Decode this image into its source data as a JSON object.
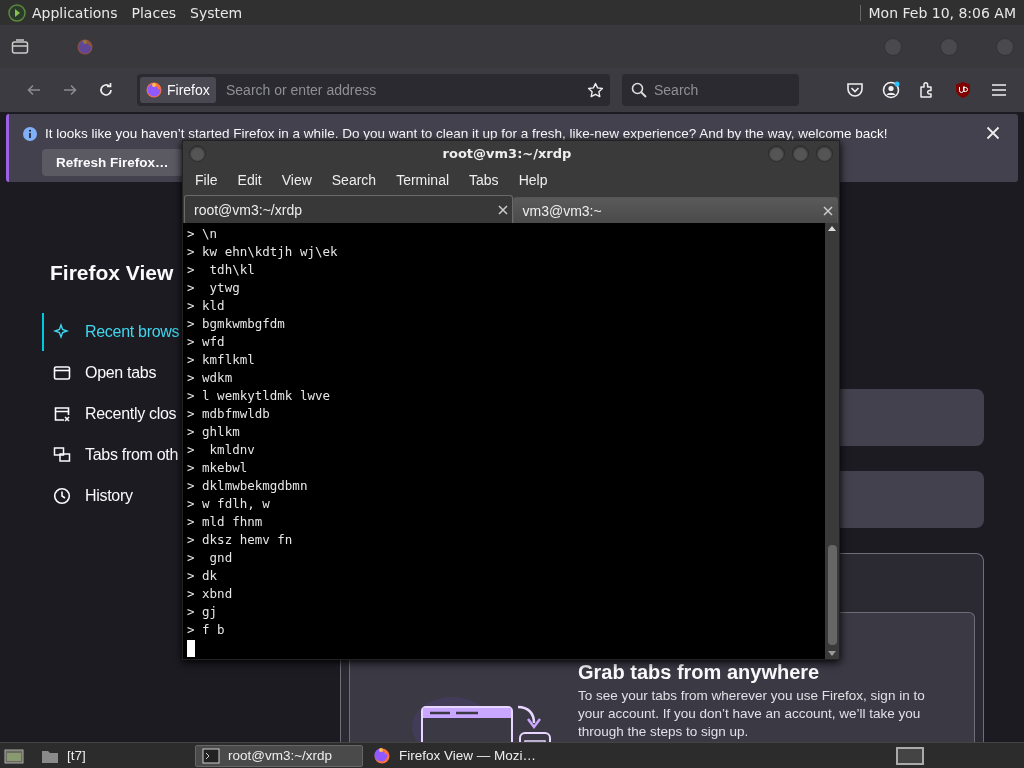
{
  "top_panel": {
    "menus": [
      "Applications",
      "Places",
      "System"
    ],
    "clock": "Mon Feb 10, 8:06 AM"
  },
  "firefox": {
    "url_bar": {
      "identity": "Firefox",
      "placeholder": "Search or enter address"
    },
    "search": {
      "placeholder": "Search"
    },
    "notification": {
      "message": "It looks like you haven’t started Firefox in a while. Do you want to clean it up for a fresh, like-new experience? And by the way, welcome back!",
      "button": "Refresh Firefox…"
    },
    "view": {
      "title": "Firefox View",
      "nav": [
        {
          "label": "Recent brows",
          "kind": "sparkle",
          "selected": true
        },
        {
          "label": "Open tabs",
          "kind": "tabs",
          "selected": false
        },
        {
          "label": "Recently clos",
          "kind": "closed",
          "selected": false
        },
        {
          "label": "Tabs from oth",
          "kind": "devices",
          "selected": false
        },
        {
          "label": "History",
          "kind": "clock",
          "selected": false
        }
      ],
      "promo": {
        "title": "Grab tabs from anywhere",
        "body": "To see your tabs from wherever you use Firefox, sign in to your account. If you don’t have an account, we’ll take you through the steps to sign up."
      }
    }
  },
  "terminal": {
    "title": "root@vm3:~/xrdp",
    "menu": [
      "File",
      "Edit",
      "View",
      "Search",
      "Terminal",
      "Tabs",
      "Help"
    ],
    "tabs": [
      {
        "label": "root@vm3:~/xrdp",
        "selected": true
      },
      {
        "label": "vm3@vm3:~",
        "selected": false
      }
    ],
    "lines": [
      "> \\n",
      "> kw ehn\\kdtjh wj\\ek",
      ">  tdh\\kl",
      ">  ytwg",
      "> kld",
      "> bgmkwmbgfdm",
      "> wfd",
      "> kmflkml",
      "> wdkm",
      "> l wemkytldmk lwve",
      "> mdbfmwldb",
      "> ghlkm",
      ">  kmldnv",
      "> mkebwl",
      "> dklmwbekmgdbmn",
      "> w fdlh, w",
      "> mld fhnm",
      "> dksz hemv fn",
      ">  gnd",
      "> dk",
      "> xbnd",
      "> gj",
      "> f b"
    ]
  },
  "taskbar": {
    "items": [
      {
        "label": "[t7]",
        "kind": "folder",
        "selected": false
      },
      {
        "label": "root@vm3:~/xrdp",
        "kind": "terminal",
        "selected": true
      },
      {
        "label": "Firefox View — Mozi…",
        "kind": "firefox",
        "selected": false
      }
    ]
  }
}
